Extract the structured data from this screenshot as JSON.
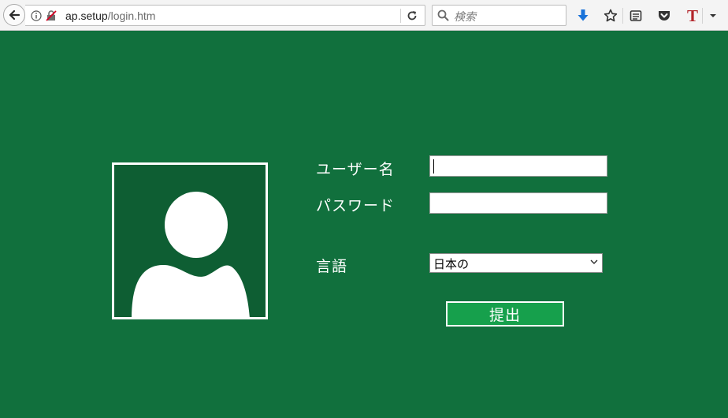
{
  "browser": {
    "url_host": "ap.setup",
    "url_path": "/login.htm",
    "search_placeholder": "検索",
    "toolbar_icons": [
      "back-arrow-icon",
      "info-icon",
      "insecure-lock-icon",
      "reload-icon",
      "search-icon",
      "download-icon",
      "bookmark-star-icon",
      "reader-view-icon",
      "pocket-icon",
      "translate-t-icon",
      "menu-dropdown-icon"
    ],
    "colors": {
      "download_icon": "#1a73d9",
      "t_icon": "#b3252b"
    }
  },
  "login": {
    "username_label": "ユーザー名",
    "username_value": "",
    "password_label": "パスワード",
    "password_value": "",
    "language_label": "言語",
    "language_selected": "日本の",
    "submit_label": "提出",
    "avatar_icon": "user-silhouette-icon",
    "colors": {
      "background": "#11703d",
      "avatar_panel": "#0e5e33",
      "submit_button": "#16a04c"
    }
  }
}
